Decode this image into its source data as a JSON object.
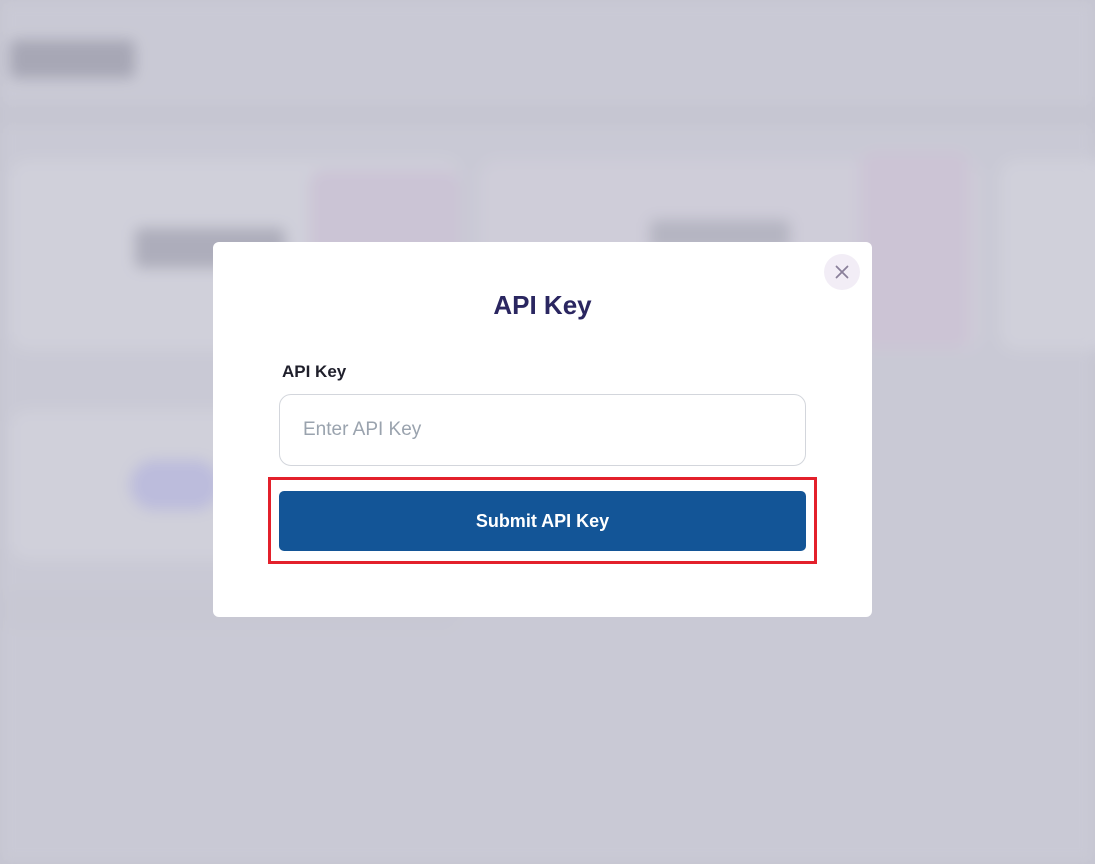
{
  "modal": {
    "title": "API Key",
    "field_label": "API Key",
    "input": {
      "value": "",
      "placeholder": "Enter API Key"
    },
    "submit_label": "Submit API Key",
    "close_icon": "close-icon"
  },
  "colors": {
    "primary_button": "#135597",
    "title": "#2a2660",
    "highlight_border": "#e3202b",
    "backdrop": "#c9c9d4"
  }
}
